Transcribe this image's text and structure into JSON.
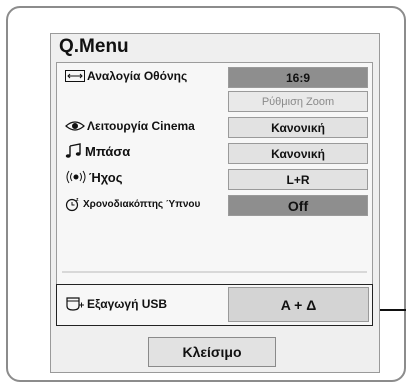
{
  "menu": {
    "title": "Q.Menu",
    "rows": [
      {
        "label": "Αναλογία Οθόνης",
        "value": "16:9",
        "icon": "aspect-ratio-icon"
      },
      {
        "label": "",
        "value": "Ρύθμιση Zoom",
        "icon": ""
      },
      {
        "label": "Λειτουργία Cinema",
        "value": "Κανονική",
        "icon": "eye-icon"
      },
      {
        "label": "Μπάσα",
        "value": "Κανονική",
        "icon": "music-note-icon"
      },
      {
        "label": "Ήχος",
        "value": "L+R",
        "icon": "speaker-waves-icon"
      },
      {
        "label": "Χρονοδιακόπτης Ύπνου",
        "value": "Off",
        "icon": "clock-z-icon"
      }
    ],
    "usb": {
      "label": "Εξαγωγή USB",
      "value": "A + Δ",
      "icon": "usb-eject-icon"
    },
    "close_label": "Κλείσιμο"
  },
  "colors": {
    "selected_value_bg": "#8e8e8e",
    "value_bg": "#e2e2e2",
    "panel_bg": "#efefef"
  }
}
